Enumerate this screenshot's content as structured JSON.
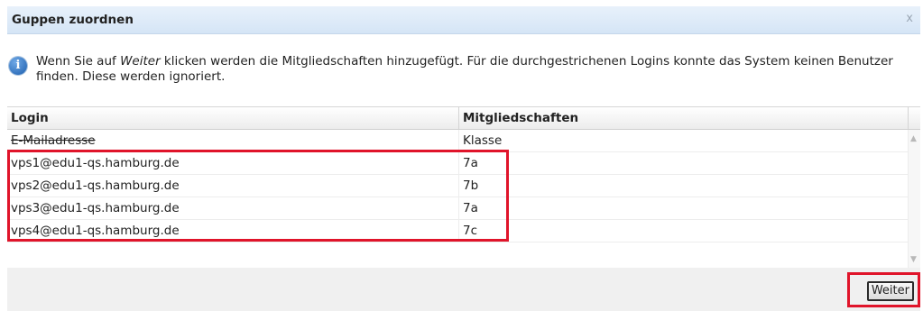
{
  "dialog": {
    "title": "Guppen zuordnen",
    "close_icon": "close-icon",
    "close_glyph": "x"
  },
  "info": {
    "icon": "info-icon",
    "glyph": "i",
    "text_before": "Wenn Sie auf ",
    "text_emphasis": "Weiter",
    "text_after": " klicken werden die Mitgliedschaften hinzugefügt. Für die durchgestrichenen Logins konnte das System keinen Benutzer finden. Diese werden ignoriert."
  },
  "grid": {
    "columns": [
      "Login",
      "Mitgliedschaften"
    ],
    "rows": [
      {
        "login": "E-Mailadresse",
        "group": "Klasse",
        "struck": true
      },
      {
        "login": "vps1@edu1-qs.hamburg.de",
        "group": "7a",
        "struck": false
      },
      {
        "login": "vps2@edu1-qs.hamburg.de",
        "group": "7b",
        "struck": false
      },
      {
        "login": "vps3@edu1-qs.hamburg.de",
        "group": "7a",
        "struck": false
      },
      {
        "login": "vps4@edu1-qs.hamburg.de",
        "group": "7c",
        "struck": false
      }
    ]
  },
  "footer": {
    "next_label": "Weiter"
  },
  "colors": {
    "highlight": "#e0142a",
    "title_bg": "#d5e5f6"
  }
}
